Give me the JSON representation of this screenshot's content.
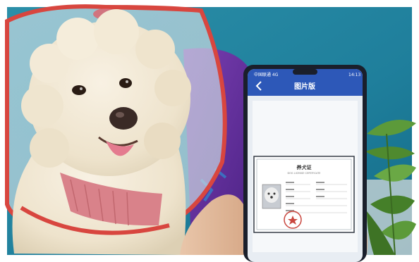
{
  "phone": {
    "status_left": "中国联通 4G",
    "status_time": "14:13",
    "app_title": "图片版",
    "back_icon": "back-arrow-icon"
  },
  "certificate": {
    "title": "养犬证",
    "subtitle": "DOG LICENSE CERTIFICATE"
  },
  "colors": {
    "background_blue": "#1f7f9c",
    "app_bar_blue": "#2d58b8",
    "cone_red": "#d8463f",
    "stamp_red": "#c9473f"
  }
}
